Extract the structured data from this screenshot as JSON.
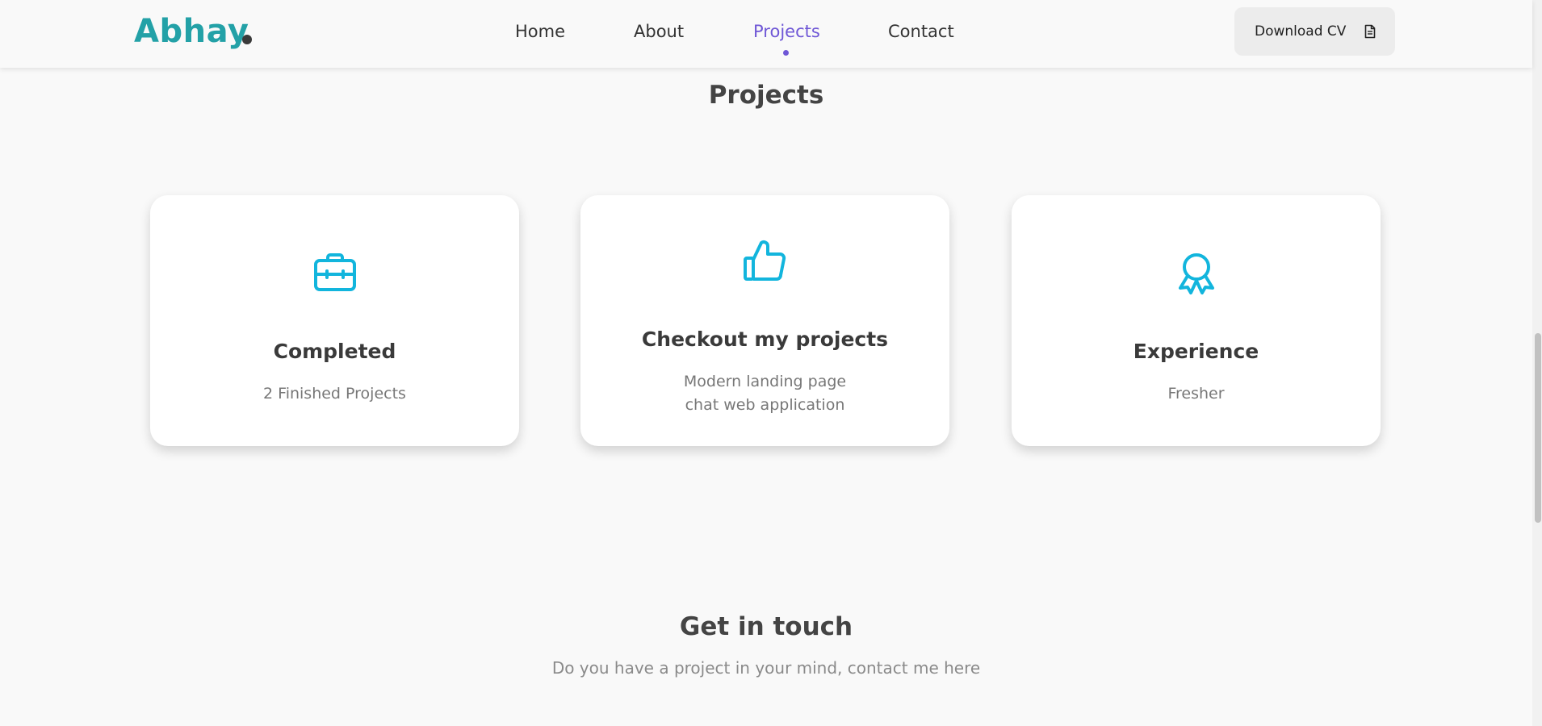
{
  "header": {
    "logo_text": "Abhay",
    "nav": {
      "home": "Home",
      "about": "About",
      "projects": "Projects",
      "contact": "Contact"
    },
    "active_nav": "Projects",
    "cv_button_label": "Download CV",
    "accent_color": "#6f57d6",
    "brand_color": "#23a1a7"
  },
  "projects": {
    "title": "Projects",
    "icon_color": "#12b5dd",
    "cards": [
      {
        "icon": "briefcase-icon",
        "title": "Completed",
        "line1": "2 Finished Projects"
      },
      {
        "icon": "thumbs-up-icon",
        "title": "Checkout my projects",
        "line1": "Modern landing page",
        "line2": "chat web application"
      },
      {
        "icon": "award-icon",
        "title": "Experience",
        "line1": "Fresher"
      }
    ]
  },
  "contact": {
    "title": "Get in touch",
    "subtitle": "Do you have a project in your mind, contact me here"
  }
}
